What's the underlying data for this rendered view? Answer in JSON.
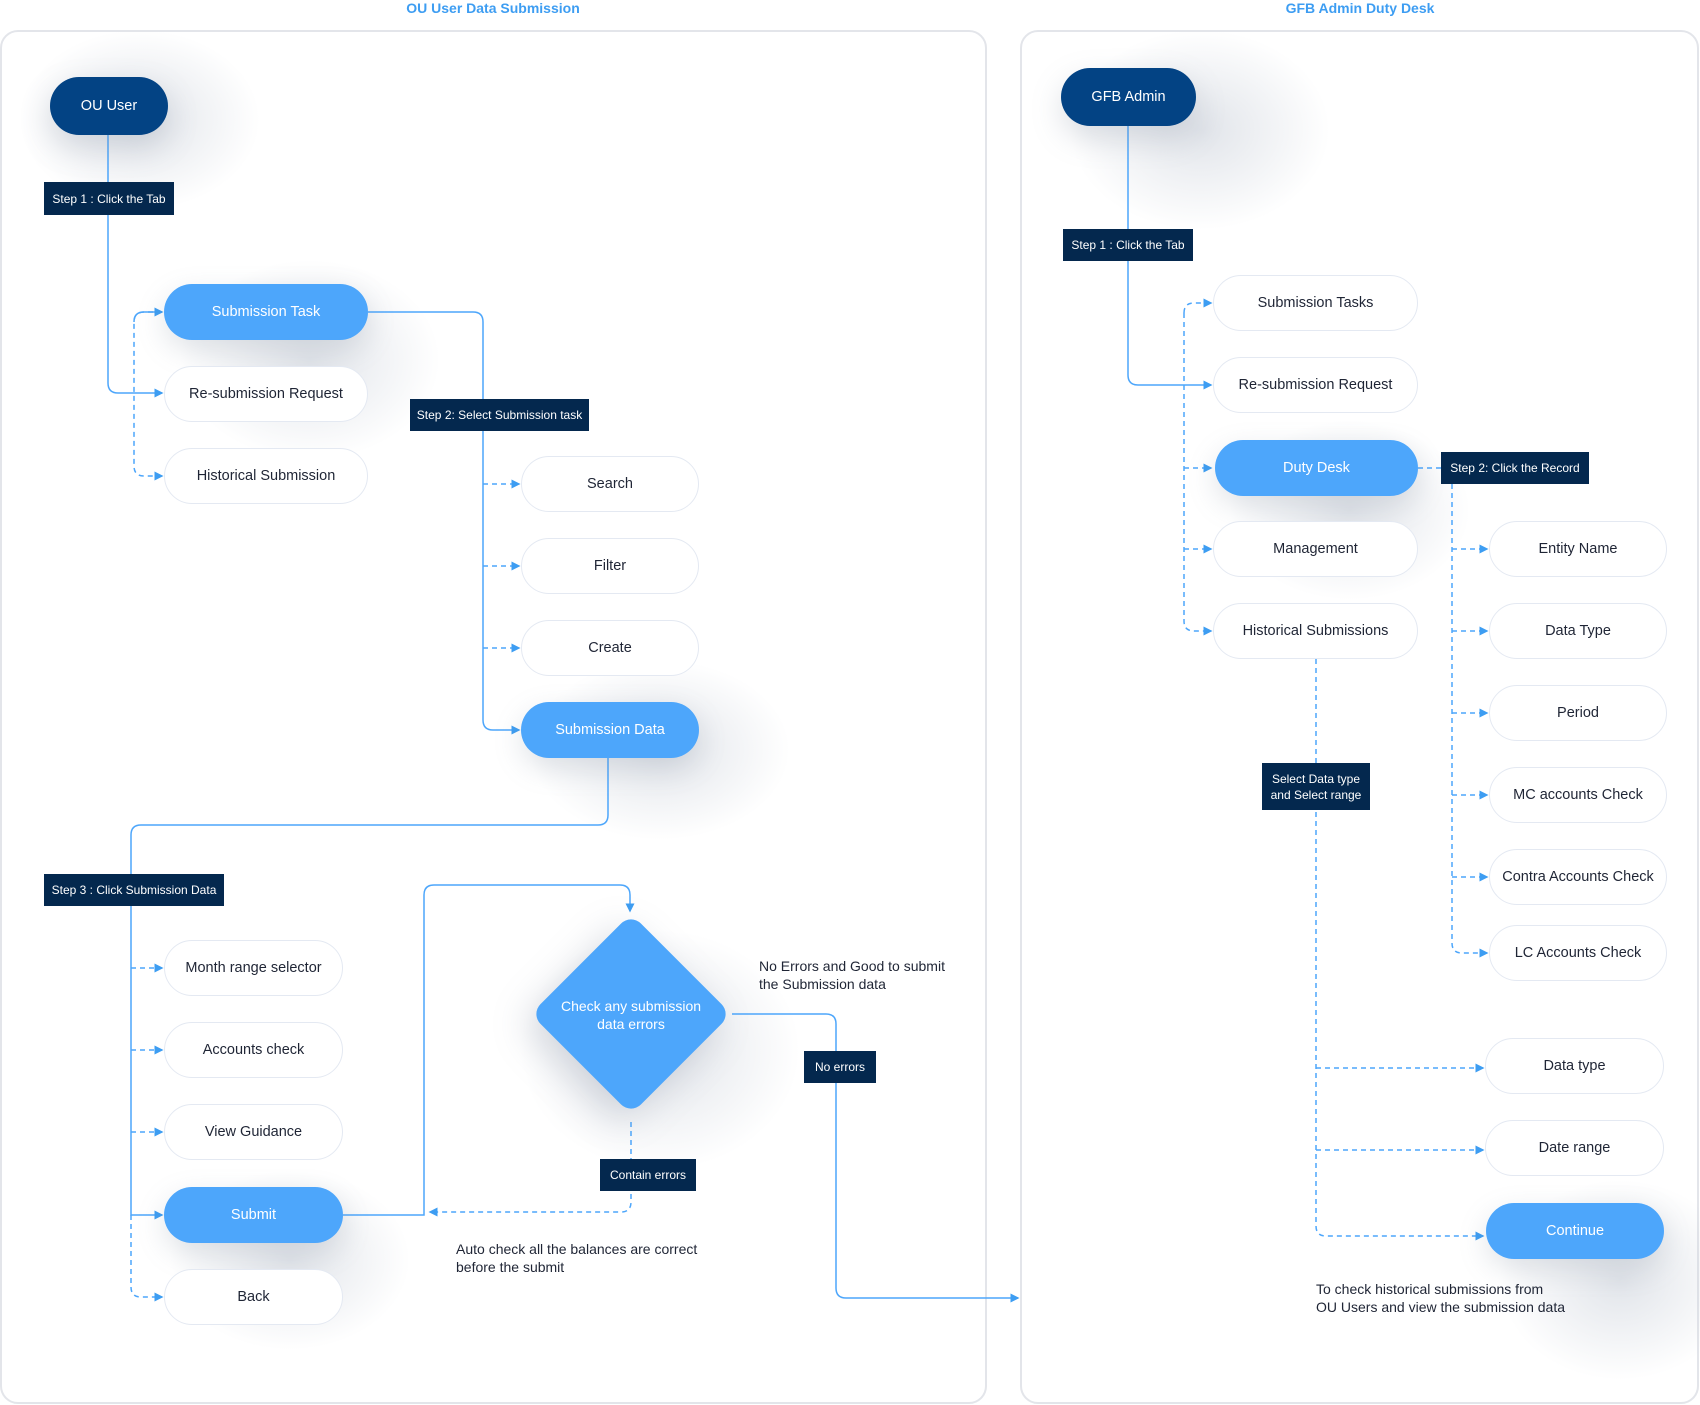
{
  "panels": {
    "left": {
      "title": "OU User Data Submission"
    },
    "right": {
      "title": "GFB Admin  Duty Desk"
    }
  },
  "colors": {
    "actor": "#034384",
    "active": "#4da6fb",
    "label_bg": "#04284e",
    "connector": "#3d9df2",
    "title": "#3d9df2"
  },
  "left": {
    "actor": "OU User",
    "step1": "Step 1 : Click the Tab",
    "tabs": [
      "Submission Task",
      "Re-submission Request",
      "Historical Submission"
    ],
    "step2": "Step 2: Select Submission task",
    "task_actions": [
      "Search",
      "Filter",
      "Create",
      "Submission Data"
    ],
    "step3": "Step 3 : Click Submission Data",
    "data_actions": [
      "Month range selector",
      "Accounts check",
      "View Guidance",
      "Submit",
      "Back"
    ],
    "decision": "Check any submission\ndata errors",
    "no_errors_label": "No errors",
    "contain_errors_label": "Contain errors",
    "no_errors_note": "No Errors and Good to submit\nthe Submission data",
    "auto_check_note": "Auto check all the balances are correct\nbefore the submit"
  },
  "right": {
    "actor": "GFB Admin",
    "step1": "Step 1 : Click the Tab",
    "tabs": [
      "Submission Tasks",
      "Re-submission Request",
      "Duty Desk",
      "Management",
      "Historical Submissions"
    ],
    "step2": "Step 2: Click the Record",
    "record_fields": [
      "Entity Name",
      "Data Type",
      "Period",
      "MC accounts Check",
      "Contra Accounts Check",
      "LC Accounts Check"
    ],
    "select_label": "Select Data type\nand Select range",
    "history_actions": [
      "Data type",
      "Date range",
      "Continue"
    ],
    "history_note": "To check historical submissions from\nOU Users and view the submission data"
  }
}
